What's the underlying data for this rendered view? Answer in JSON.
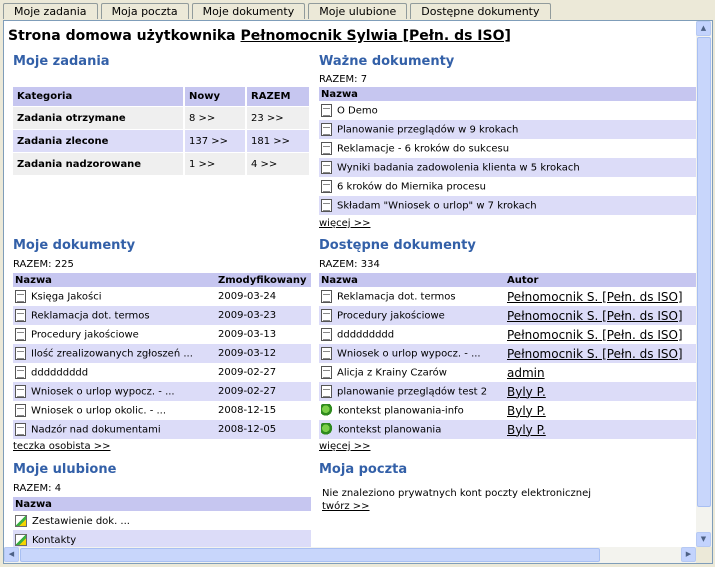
{
  "tabs": [
    "Moje zadania",
    "Moja poczta",
    "Moje dokumenty",
    "Moje ulubione",
    "Dostępne dokumenty"
  ],
  "header": {
    "prefix": "Strona domowa użytkownika",
    "user": "Pełnomocnik Sylwia [Pełn. ds ISO]"
  },
  "tasks": {
    "title": "Moje zadania",
    "columns": [
      "Kategoria",
      "Nowy",
      "RAZEM"
    ],
    "rows": [
      {
        "category": "Zadania otrzymane",
        "new": "8 >>",
        "total": "23 >>"
      },
      {
        "category": "Zadania zlecone",
        "new": "137 >>",
        "total": "181 >>"
      },
      {
        "category": "Zadania nadzorowane",
        "new": "1 >>",
        "total": "4 >>"
      }
    ]
  },
  "important": {
    "title": "Ważne dokumenty",
    "total": "RAZEM: 7",
    "column": "Nazwa",
    "items": [
      "O Demo",
      "Planowanie przeglądów w 9 krokach",
      "Reklamacje - 6 kroków do sukcesu",
      "Wyniki badania zadowolenia klienta w 5 krokach",
      "6 kroków do Miernika procesu",
      "Składam \"Wniosek o urlop\" w 7 krokach"
    ],
    "more": "więcej >>"
  },
  "mydocs": {
    "title": "Moje dokumenty",
    "total": "RAZEM: 225",
    "columns": [
      "Nazwa",
      "Zmodyfikowany"
    ],
    "rows": [
      {
        "name": "Księga Jakości",
        "date": "2009-03-24"
      },
      {
        "name": "Reklamacja dot. termos",
        "date": "2009-03-23"
      },
      {
        "name": "Procedury jakościowe",
        "date": "2009-03-13"
      },
      {
        "name": "Ilość zrealizowanych zgłoszeń ...",
        "date": "2009-03-12"
      },
      {
        "name": "ddddddddd",
        "date": "2009-02-27"
      },
      {
        "name": "Wniosek o urlop wypocz. - ...",
        "date": "2009-02-27"
      },
      {
        "name": "Wniosek o urlop okolic. - ...",
        "date": "2008-12-15"
      },
      {
        "name": "Nadzór nad dokumentami",
        "date": "2008-12-05"
      }
    ],
    "more": "teczka osobista >>"
  },
  "available": {
    "title": "Dostępne dokumenty",
    "total": "RAZEM: 334",
    "columns": [
      "Nazwa",
      "Autor"
    ],
    "rows": [
      {
        "name": "Reklamacja dot. termos",
        "author": "Pełnomocnik S. [Pełn. ds ISO]",
        "icon": "document-icon"
      },
      {
        "name": "Procedury jakościowe",
        "author": "Pełnomocnik S. [Pełn. ds ISO]",
        "icon": "document-icon"
      },
      {
        "name": "ddddddddd",
        "author": "Pełnomocnik S. [Pełn. ds ISO]",
        "icon": "document-icon"
      },
      {
        "name": "Wniosek o urlop wypocz. - ...",
        "author": "Pełnomocnik S. [Pełn. ds ISO]",
        "icon": "document-icon"
      },
      {
        "name": "Alicja z Krainy Czarów",
        "author": "admin",
        "icon": "document-icon"
      },
      {
        "name": "planowanie przeglądów test 2",
        "author": "Byly P.",
        "icon": "document-icon"
      },
      {
        "name": "kontekst planowania-info",
        "author": "Byly P.",
        "icon": "process-icon"
      },
      {
        "name": "kontekst planowania",
        "author": "Byly P.",
        "icon": "process-icon"
      }
    ],
    "more": "więcej >>"
  },
  "favorites": {
    "title": "Moje ulubione",
    "total": "RAZEM: 4",
    "column": "Nazwa",
    "items": [
      "Zestawienie dok. ...",
      "Kontakty"
    ]
  },
  "mail": {
    "title": "Moja poczta",
    "message": "Nie znaleziono prywatnych kont poczty elektronicznej",
    "create": "twórz >>"
  }
}
